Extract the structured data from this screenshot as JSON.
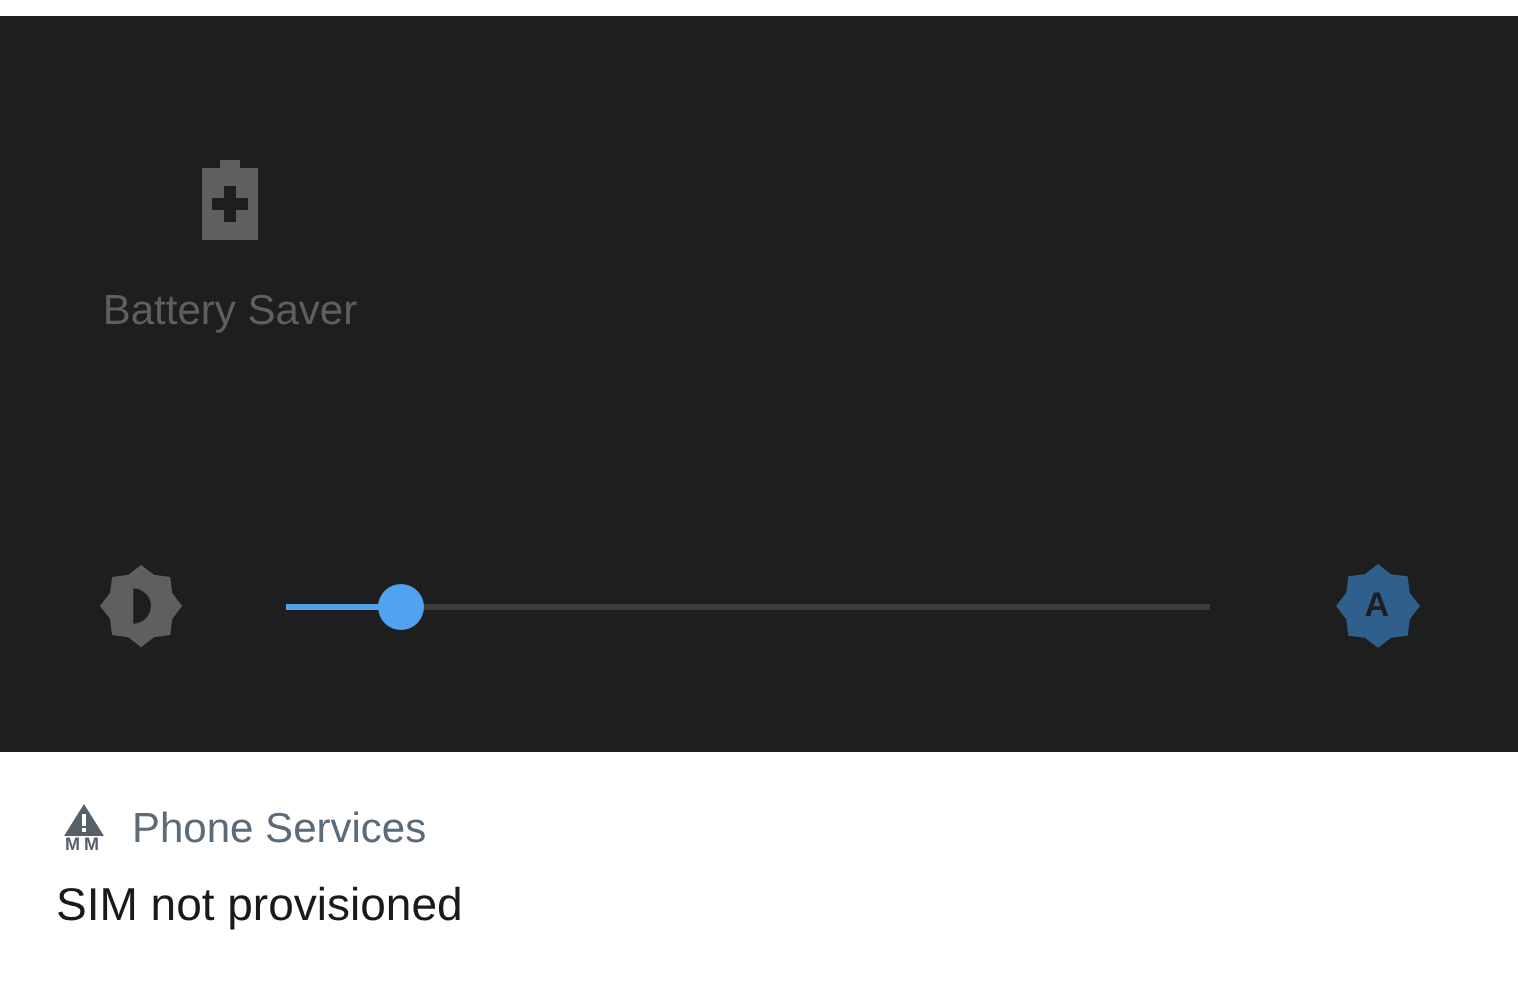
{
  "quick_settings": {
    "tiles": [
      {
        "label": "Battery Saver",
        "on": false
      }
    ]
  },
  "brightness": {
    "level": 0.123,
    "auto": true,
    "auto_label": "A"
  },
  "notification": {
    "app_badge": "MM",
    "app": "Phone Services",
    "text": "SIM not provisioned"
  }
}
